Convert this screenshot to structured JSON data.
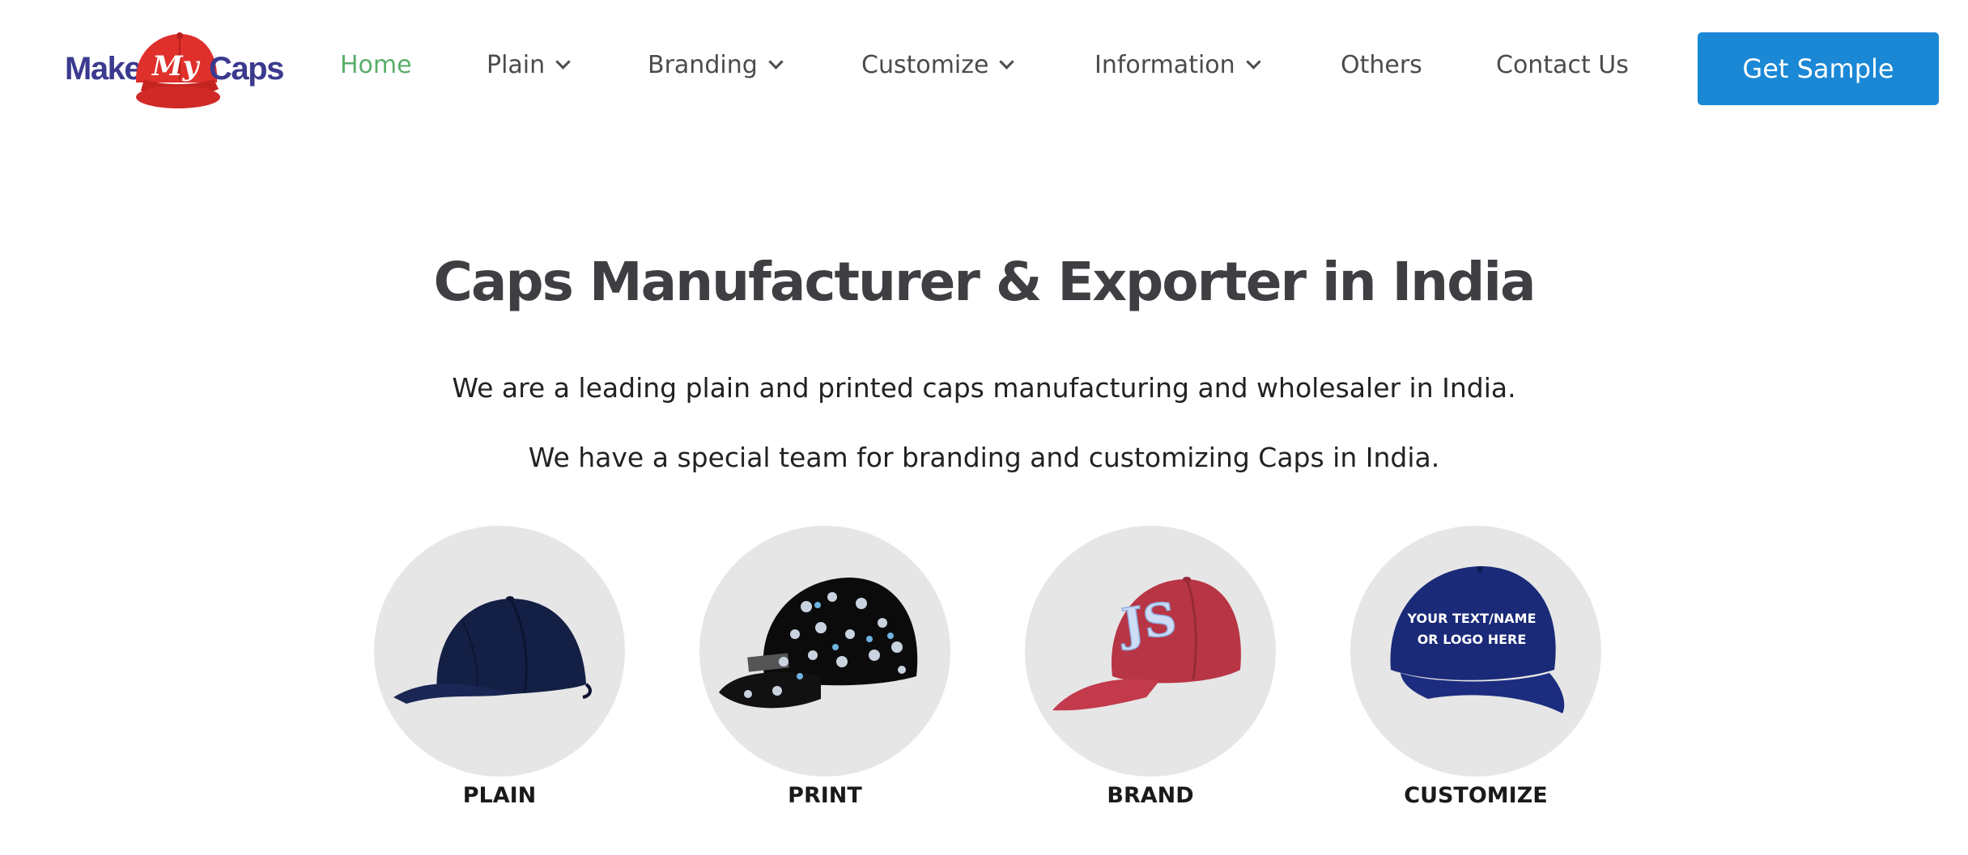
{
  "brand": {
    "logo_make": "Make",
    "logo_my": "My",
    "logo_caps": "Caps",
    "colors": {
      "navy": "#3b3a8f",
      "cap_red": "#e0302c"
    }
  },
  "nav": {
    "items": [
      {
        "label": "Home",
        "active": true,
        "has_dropdown": false
      },
      {
        "label": "Plain",
        "active": false,
        "has_dropdown": true
      },
      {
        "label": "Branding",
        "active": false,
        "has_dropdown": true
      },
      {
        "label": "Customize",
        "active": false,
        "has_dropdown": true
      },
      {
        "label": "Information",
        "active": false,
        "has_dropdown": true
      },
      {
        "label": "Others",
        "active": false,
        "has_dropdown": false
      },
      {
        "label": "Contact Us",
        "active": false,
        "has_dropdown": false
      }
    ],
    "cta_label": "Get Sample",
    "colors": {
      "active": "#5aae6a",
      "cta": "#1b88d6"
    }
  },
  "hero": {
    "title": "Caps Manufacturer & Exporter in India",
    "line1": "We are a leading plain and printed caps manufacturing and wholesaler in India.",
    "line2": "We have a special team for branding and customizing Caps in India."
  },
  "categories": [
    {
      "label": "PLAIN",
      "icon": "plain-navy-cap"
    },
    {
      "label": "PRINT",
      "icon": "printed-black-cap"
    },
    {
      "label": "BRAND",
      "icon": "branded-red-cap"
    },
    {
      "label": "CUSTOMIZE",
      "icon": "custom-navy-cap",
      "cap_text_1": "YOUR TEXT/NAME",
      "cap_text_2": "OR LOGO HERE"
    }
  ]
}
